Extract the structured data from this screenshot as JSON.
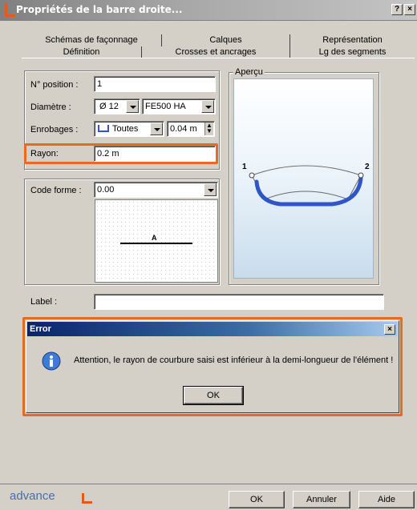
{
  "window": {
    "title": "Propriétés de la barre droite...",
    "help_glyph": "?",
    "close_glyph": "×"
  },
  "tabs": {
    "back_row": [
      "Schémas de façonnage",
      "Calques",
      "Représentation"
    ],
    "front_row": [
      "Définition",
      "Crosses et ancrages",
      "Lg des segments"
    ],
    "active": "Définition"
  },
  "form": {
    "position_label": "N° position :",
    "position_value": "1",
    "diametre_label": "Diamètre :",
    "diametre_value": "Ø 12",
    "steel_value": "FE500 HA",
    "enrobage_label": "Enrobages :",
    "enrobage_value": "Toutes",
    "enrobage_size": "0.04 m",
    "rayon_label": "Rayon:",
    "rayon_value": "0.2 m",
    "code_label": "Code forme :",
    "code_value": "0.00",
    "shape_letter": "A",
    "label_label": "Label :",
    "label_value": ""
  },
  "preview": {
    "title": "Aperçu",
    "marker_left": "1",
    "marker_right": "2"
  },
  "error_dialog": {
    "title": "Error",
    "close_glyph": "×",
    "message": "Attention, le rayon de courbure saisi est inférieur à la demi-longueur de l'élément !",
    "ok_label": "OK",
    "icon": "info-icon"
  },
  "footer": {
    "brand": "advance",
    "ok_label": "OK",
    "cancel_label": "Annuler",
    "help_label": "Aide"
  },
  "colors": {
    "highlight": "#e8691f",
    "rebar": "#2f56c7",
    "error_title": "#0a246a"
  }
}
